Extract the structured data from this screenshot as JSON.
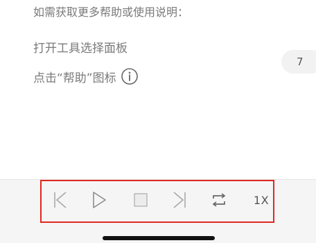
{
  "help": {
    "intro": "如需获取更多帮助或使用说明：",
    "step_open": "打开工具选择面板",
    "step_click": "点击“帮助”图标"
  },
  "page_indicator": "7",
  "player": {
    "speed_label": "1X",
    "controls": [
      "skip-back-icon",
      "play-icon",
      "stop-icon",
      "skip-forward-icon",
      "repeat-icon"
    ]
  },
  "colors": {
    "highlight": "#e0281f",
    "icon": "#a8a8a8",
    "text": "#7a7a7a"
  }
}
